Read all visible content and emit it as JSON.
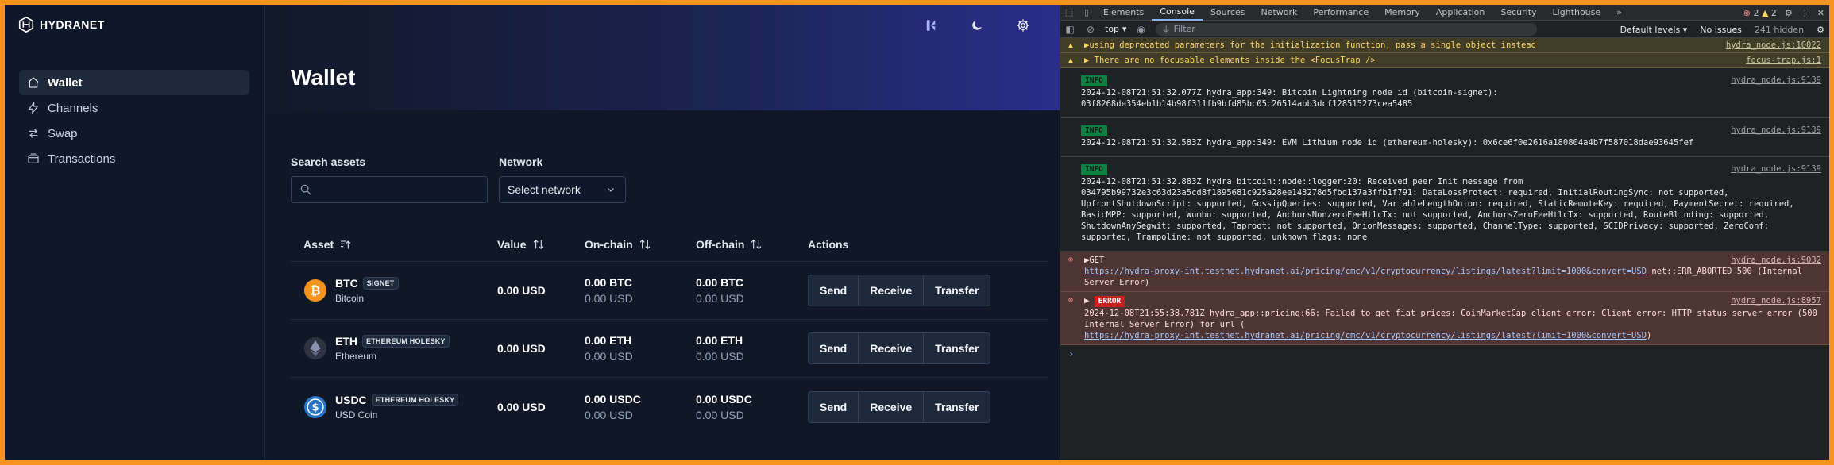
{
  "app": {
    "brand": "HYDRANET",
    "sidebar": {
      "items": [
        {
          "label": "Wallet",
          "icon": "home-icon",
          "active": true
        },
        {
          "label": "Channels",
          "icon": "lightning-icon",
          "active": false
        },
        {
          "label": "Swap",
          "icon": "swap-icon",
          "active": false
        },
        {
          "label": "Transactions",
          "icon": "transactions-icon",
          "active": false
        }
      ]
    },
    "page_title": "Wallet",
    "search": {
      "label": "Search assets",
      "placeholder": ""
    },
    "network": {
      "label": "Network",
      "selected": "Select network"
    },
    "table": {
      "headers": {
        "asset": "Asset",
        "value": "Value",
        "onchain": "On-chain",
        "offchain": "Off-chain",
        "actions": "Actions"
      },
      "rows": [
        {
          "symbol": "BTC",
          "badge": "SIGNET",
          "name": "Bitcoin",
          "value": "0.00 USD",
          "onchain": "0.00 BTC",
          "onchain_usd": "0.00 USD",
          "offchain": "0.00 BTC",
          "offchain_usd": "0.00 USD",
          "color": "#f7931a"
        },
        {
          "symbol": "ETH",
          "badge": "ETHEREUM HOLESKY",
          "name": "Ethereum",
          "value": "0.00 USD",
          "onchain": "0.00 ETH",
          "onchain_usd": "0.00 USD",
          "offchain": "0.00 ETH",
          "offchain_usd": "0.00 USD",
          "color": "#3c3c3d"
        },
        {
          "symbol": "USDC",
          "badge": "ETHEREUM HOLESKY",
          "name": "USD Coin",
          "value": "0.00 USD",
          "onchain": "0.00 USDC",
          "onchain_usd": "0.00 USD",
          "offchain": "0.00 USDC",
          "offchain_usd": "0.00 USD",
          "color": "#2775ca"
        }
      ],
      "actions": {
        "send": "Send",
        "receive": "Receive",
        "transfer": "Transfer"
      }
    }
  },
  "devtools": {
    "tabs": [
      "Elements",
      "Console",
      "Sources",
      "Network",
      "Performance",
      "Memory",
      "Application",
      "Security",
      "Lighthouse"
    ],
    "active_tab": "Console",
    "more": "»",
    "error_count": "2",
    "warning_count": "2",
    "context": "top",
    "filter_placeholder": "Filter",
    "levels": "Default levels",
    "issues": "No Issues",
    "hidden": "241 hidden",
    "messages": [
      {
        "type": "warn",
        "text": "▶using deprecated parameters for the initialization function; pass a single object instead",
        "src": "hydra_node.js:10022"
      },
      {
        "type": "warn",
        "text": "▶ There are no focusable elements inside the <FocusTrap />",
        "src": "focus-trap.js:1"
      },
      {
        "type": "info",
        "tag": "INFO",
        "text": "2024-12-08T21:51:32.077Z hydra_app:349: Bitcoin Lightning node id (bitcoin-signet): 03f8268de354eb1b14b98f311fb9bfd85bc05c26514abb3dcf128515273cea5485",
        "src": "hydra_node.js:9139"
      },
      {
        "type": "info",
        "tag": "INFO",
        "text": "2024-12-08T21:51:32.583Z hydra_app:349: EVM Lithium node id (ethereum-holesky): 0x6ce6f0e2616a180804a4b7f587018dae93645fef",
        "src": "hydra_node.js:9139"
      },
      {
        "type": "info",
        "tag": "INFO",
        "text": "2024-12-08T21:51:32.883Z hydra_bitcoin::node::logger:20: Received peer Init message from 034795b99732e3c63d23a5cd8f1895681c925a28ee143278d5fbd137a3ffb1f791: DataLossProtect: required, InitialRoutingSync: not supported, UpfrontShutdownScript: supported, GossipQueries: supported, VariableLengthOnion: required, StaticRemoteKey: required, PaymentSecret: required, BasicMPP: supported, Wumbo: supported, AnchorsNonzeroFeeHtlcTx: not supported, AnchorsZeroFeeHtlcTx: supported, RouteBlinding: supported, ShutdownAnySegwit: supported, Taproot: not supported, OnionMessages: supported, ChannelType: supported, SCIDPrivacy: supported, ZeroConf: supported, Trampoline: not supported, unknown flags: none",
        "src": "hydra_node.js:9139"
      },
      {
        "type": "error",
        "prefix": "▶GET",
        "link": "https://hydra-proxy-int.testnet.hydranet.ai/pricing/cmc/v1/cryptocurrency/listings/latest?limit=1000&convert=USD",
        "text": " net::ERR_ABORTED 500 (Internal Server Error)",
        "src": "hydra_node.js:9032"
      },
      {
        "type": "error",
        "tag": "ERROR",
        "text": "2024-12-08T21:55:38.781Z hydra_app::pricing:66: Failed to get fiat prices: CoinMarketCap client error: Client error: HTTP status server error (500 Internal Server Error) for url (",
        "link": "https://hydra-proxy-int.testnet.hydranet.ai/pricing/cmc/v1/cryptocurrency/listings/latest?limit=1000&convert=USD",
        "suffix": ")",
        "src": "hydra_node.js:8957"
      }
    ],
    "prompt": "›"
  }
}
